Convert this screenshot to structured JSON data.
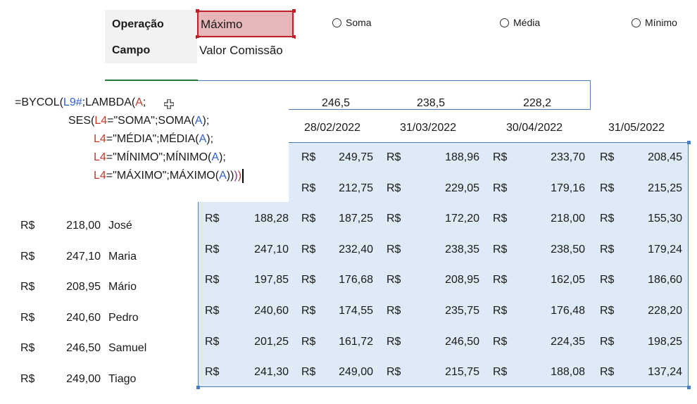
{
  "params": {
    "operation_label": "Operação",
    "operation_value": "Máximo",
    "field_label": "Campo",
    "field_value": "Valor Comissão"
  },
  "radios": [
    {
      "label": "Soma"
    },
    {
      "label": "Média"
    },
    {
      "label": "Mínimo"
    }
  ],
  "formula": {
    "l1a": "=BYCOL(",
    "l1b": "L9#",
    "l1c": ";LAMBDA(",
    "l1d": "A",
    "l1e": ";",
    "l2a": "SES(",
    "l2b": "L4",
    "l2c": "=\"SOMA\";SOMA(",
    "l2d": "A",
    "l2e": ");",
    "l3a": "L4",
    "l3b": "=\"MÉDIA\";MÉDIA(",
    "l3c": "A",
    "l3d": ");",
    "l4a": "L4",
    "l4b": "=\"MÍNIMO\";MÍNIMO(",
    "l4c": "A",
    "l4d": ");",
    "l5a": "L4",
    "l5b": "=\"MÁXIMO\";MÁXIMO(",
    "l5c": "A",
    "l5d": "))",
    "l5e": ")",
    "l5f": ")"
  },
  "results": [
    "246,5",
    "238,5",
    "228,2"
  ],
  "dates": [
    "28/02/2022",
    "31/03/2022",
    "30/04/2022",
    "31/05/2022"
  ],
  "currency": "R$",
  "people": [
    {
      "value": "218,00",
      "name": "José"
    },
    {
      "value": "247,10",
      "name": "Maria"
    },
    {
      "value": "208,95",
      "name": "Mário"
    },
    {
      "value": "240,60",
      "name": "Pedro"
    },
    {
      "value": "246,50",
      "name": "Samuel"
    },
    {
      "value": "249,00",
      "name": "Tiago"
    }
  ],
  "grid_rows": [
    [
      "",
      "249,75",
      "188,96",
      "233,70",
      "208,45"
    ],
    [
      "",
      "212,75",
      "229,05",
      "179,16",
      "215,25"
    ],
    [
      "188,28",
      "187,25",
      "172,20",
      "218,00",
      "155,30"
    ],
    [
      "247,10",
      "232,40",
      "238,35",
      "238,50",
      "179,24"
    ],
    [
      "197,85",
      "176,68",
      "208,95",
      "162,05",
      "186,60"
    ],
    [
      "240,60",
      "174,55",
      "235,75",
      "176,48",
      "228,20"
    ],
    [
      "201,25",
      "161,72",
      "246,50",
      "224,35",
      "198,25"
    ],
    [
      "241,30",
      "249,00",
      "215,75",
      "188,08",
      "137,24"
    ]
  ],
  "colors": {
    "selection_fill": "#deeaf6",
    "selection_border": "#4a7fbf",
    "active_cell_fill": "#e6b6b9",
    "active_cell_border": "#c0202c",
    "formula_blue": "#2f5fcf",
    "formula_red": "#c0392b"
  }
}
